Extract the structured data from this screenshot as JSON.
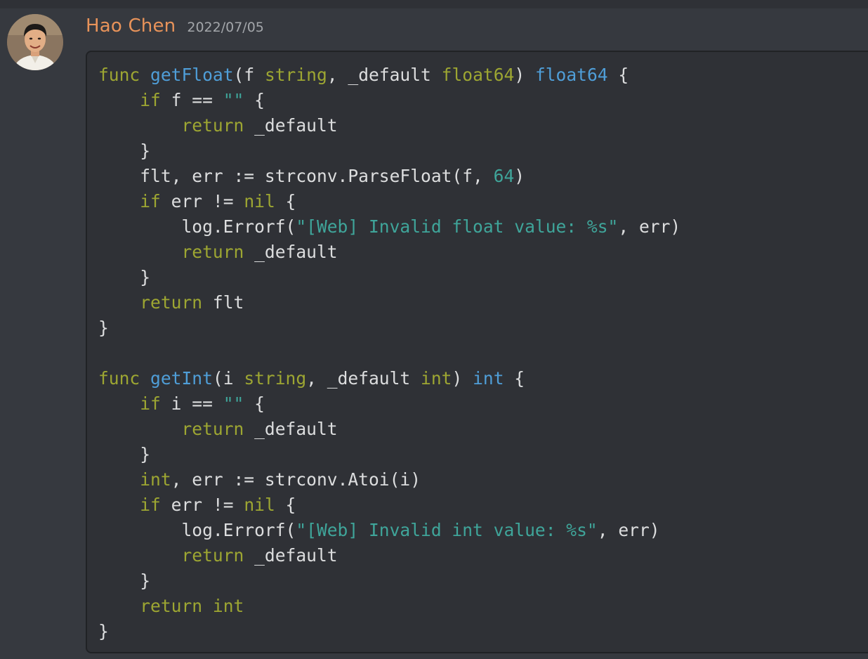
{
  "message": {
    "author": "Hao Chen",
    "timestamp": "2022/07/05",
    "avatar_icon": "user-avatar-photo"
  },
  "colors": {
    "background": "#36393f",
    "code_background": "#2f3136",
    "username": "#e8935a",
    "timestamp": "#a3a6aa",
    "keyword": "#9da632",
    "function": "#4f9ed8",
    "string": "#3fa59a",
    "plain": "#dcddde"
  },
  "code": {
    "language": "go",
    "lines": [
      [
        {
          "t": "kw",
          "v": "func"
        },
        {
          "t": "txt",
          "v": " "
        },
        {
          "t": "fn",
          "v": "getFloat"
        },
        {
          "t": "txt",
          "v": "(f "
        },
        {
          "t": "kw",
          "v": "string"
        },
        {
          "t": "txt",
          "v": ", _default "
        },
        {
          "t": "kw",
          "v": "float64"
        },
        {
          "t": "txt",
          "v": ") "
        },
        {
          "t": "fn",
          "v": "float64"
        },
        {
          "t": "txt",
          "v": " {"
        }
      ],
      [
        {
          "t": "txt",
          "v": "    "
        },
        {
          "t": "kw",
          "v": "if"
        },
        {
          "t": "txt",
          "v": " f == "
        },
        {
          "t": "str",
          "v": "\"\""
        },
        {
          "t": "txt",
          "v": " {"
        }
      ],
      [
        {
          "t": "txt",
          "v": "        "
        },
        {
          "t": "kw",
          "v": "return"
        },
        {
          "t": "txt",
          "v": " _default"
        }
      ],
      [
        {
          "t": "txt",
          "v": "    }"
        }
      ],
      [
        {
          "t": "txt",
          "v": "    flt, err := strconv.ParseFloat(f, "
        },
        {
          "t": "num",
          "v": "64"
        },
        {
          "t": "txt",
          "v": ")"
        }
      ],
      [
        {
          "t": "txt",
          "v": "    "
        },
        {
          "t": "kw",
          "v": "if"
        },
        {
          "t": "txt",
          "v": " err != "
        },
        {
          "t": "kw",
          "v": "nil"
        },
        {
          "t": "txt",
          "v": " {"
        }
      ],
      [
        {
          "t": "txt",
          "v": "        log.Errorf("
        },
        {
          "t": "str",
          "v": "\"[Web] Invalid float value: %s\""
        },
        {
          "t": "txt",
          "v": ", err)"
        }
      ],
      [
        {
          "t": "txt",
          "v": "        "
        },
        {
          "t": "kw",
          "v": "return"
        },
        {
          "t": "txt",
          "v": " _default"
        }
      ],
      [
        {
          "t": "txt",
          "v": "    }"
        }
      ],
      [
        {
          "t": "txt",
          "v": "    "
        },
        {
          "t": "kw",
          "v": "return"
        },
        {
          "t": "txt",
          "v": " flt"
        }
      ],
      [
        {
          "t": "txt",
          "v": "}"
        }
      ],
      [
        {
          "t": "txt",
          "v": ""
        }
      ],
      [
        {
          "t": "kw",
          "v": "func"
        },
        {
          "t": "txt",
          "v": " "
        },
        {
          "t": "fn",
          "v": "getInt"
        },
        {
          "t": "txt",
          "v": "(i "
        },
        {
          "t": "kw",
          "v": "string"
        },
        {
          "t": "txt",
          "v": ", _default "
        },
        {
          "t": "kw",
          "v": "int"
        },
        {
          "t": "txt",
          "v": ") "
        },
        {
          "t": "fn",
          "v": "int"
        },
        {
          "t": "txt",
          "v": " {"
        }
      ],
      [
        {
          "t": "txt",
          "v": "    "
        },
        {
          "t": "kw",
          "v": "if"
        },
        {
          "t": "txt",
          "v": " i == "
        },
        {
          "t": "str",
          "v": "\"\""
        },
        {
          "t": "txt",
          "v": " {"
        }
      ],
      [
        {
          "t": "txt",
          "v": "        "
        },
        {
          "t": "kw",
          "v": "return"
        },
        {
          "t": "txt",
          "v": " _default"
        }
      ],
      [
        {
          "t": "txt",
          "v": "    }"
        }
      ],
      [
        {
          "t": "txt",
          "v": "    "
        },
        {
          "t": "kw",
          "v": "int"
        },
        {
          "t": "txt",
          "v": ", err := strconv.Atoi(i)"
        }
      ],
      [
        {
          "t": "txt",
          "v": "    "
        },
        {
          "t": "kw",
          "v": "if"
        },
        {
          "t": "txt",
          "v": " err != "
        },
        {
          "t": "kw",
          "v": "nil"
        },
        {
          "t": "txt",
          "v": " {"
        }
      ],
      [
        {
          "t": "txt",
          "v": "        log.Errorf("
        },
        {
          "t": "str",
          "v": "\"[Web] Invalid int value: %s\""
        },
        {
          "t": "txt",
          "v": ", err)"
        }
      ],
      [
        {
          "t": "txt",
          "v": "        "
        },
        {
          "t": "kw",
          "v": "return"
        },
        {
          "t": "txt",
          "v": " _default"
        }
      ],
      [
        {
          "t": "txt",
          "v": "    }"
        }
      ],
      [
        {
          "t": "txt",
          "v": "    "
        },
        {
          "t": "kw",
          "v": "return"
        },
        {
          "t": "txt",
          "v": " "
        },
        {
          "t": "kw",
          "v": "int"
        }
      ],
      [
        {
          "t": "txt",
          "v": "}"
        }
      ]
    ]
  }
}
